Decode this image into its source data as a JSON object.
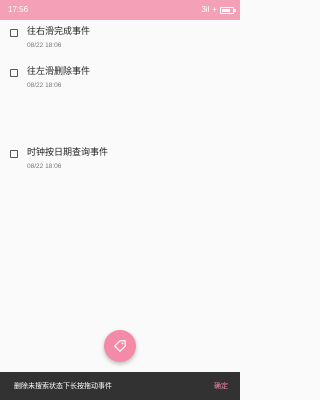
{
  "status_bar": {
    "time": "17:56",
    "signal_text": "3il",
    "battery_plus": "+"
  },
  "tasks": [
    {
      "title": "往右滑完成事件",
      "time": "08/22 18:06"
    },
    {
      "title": "往左滑删除事件",
      "time": "08/22 18:06"
    },
    {
      "title": "时钟按日期查询事件",
      "time": "08/22 18:06"
    }
  ],
  "fab": {
    "icon": "tag-icon",
    "color": "#f28aa8"
  },
  "snackbar": {
    "message": "删除未搜索状态下长按拖动事件",
    "action": "确定"
  },
  "colors": {
    "status_bar": "#f4a0b6",
    "accent": "#f28aa8",
    "background": "#fafafa",
    "snackbar": "#323232"
  }
}
